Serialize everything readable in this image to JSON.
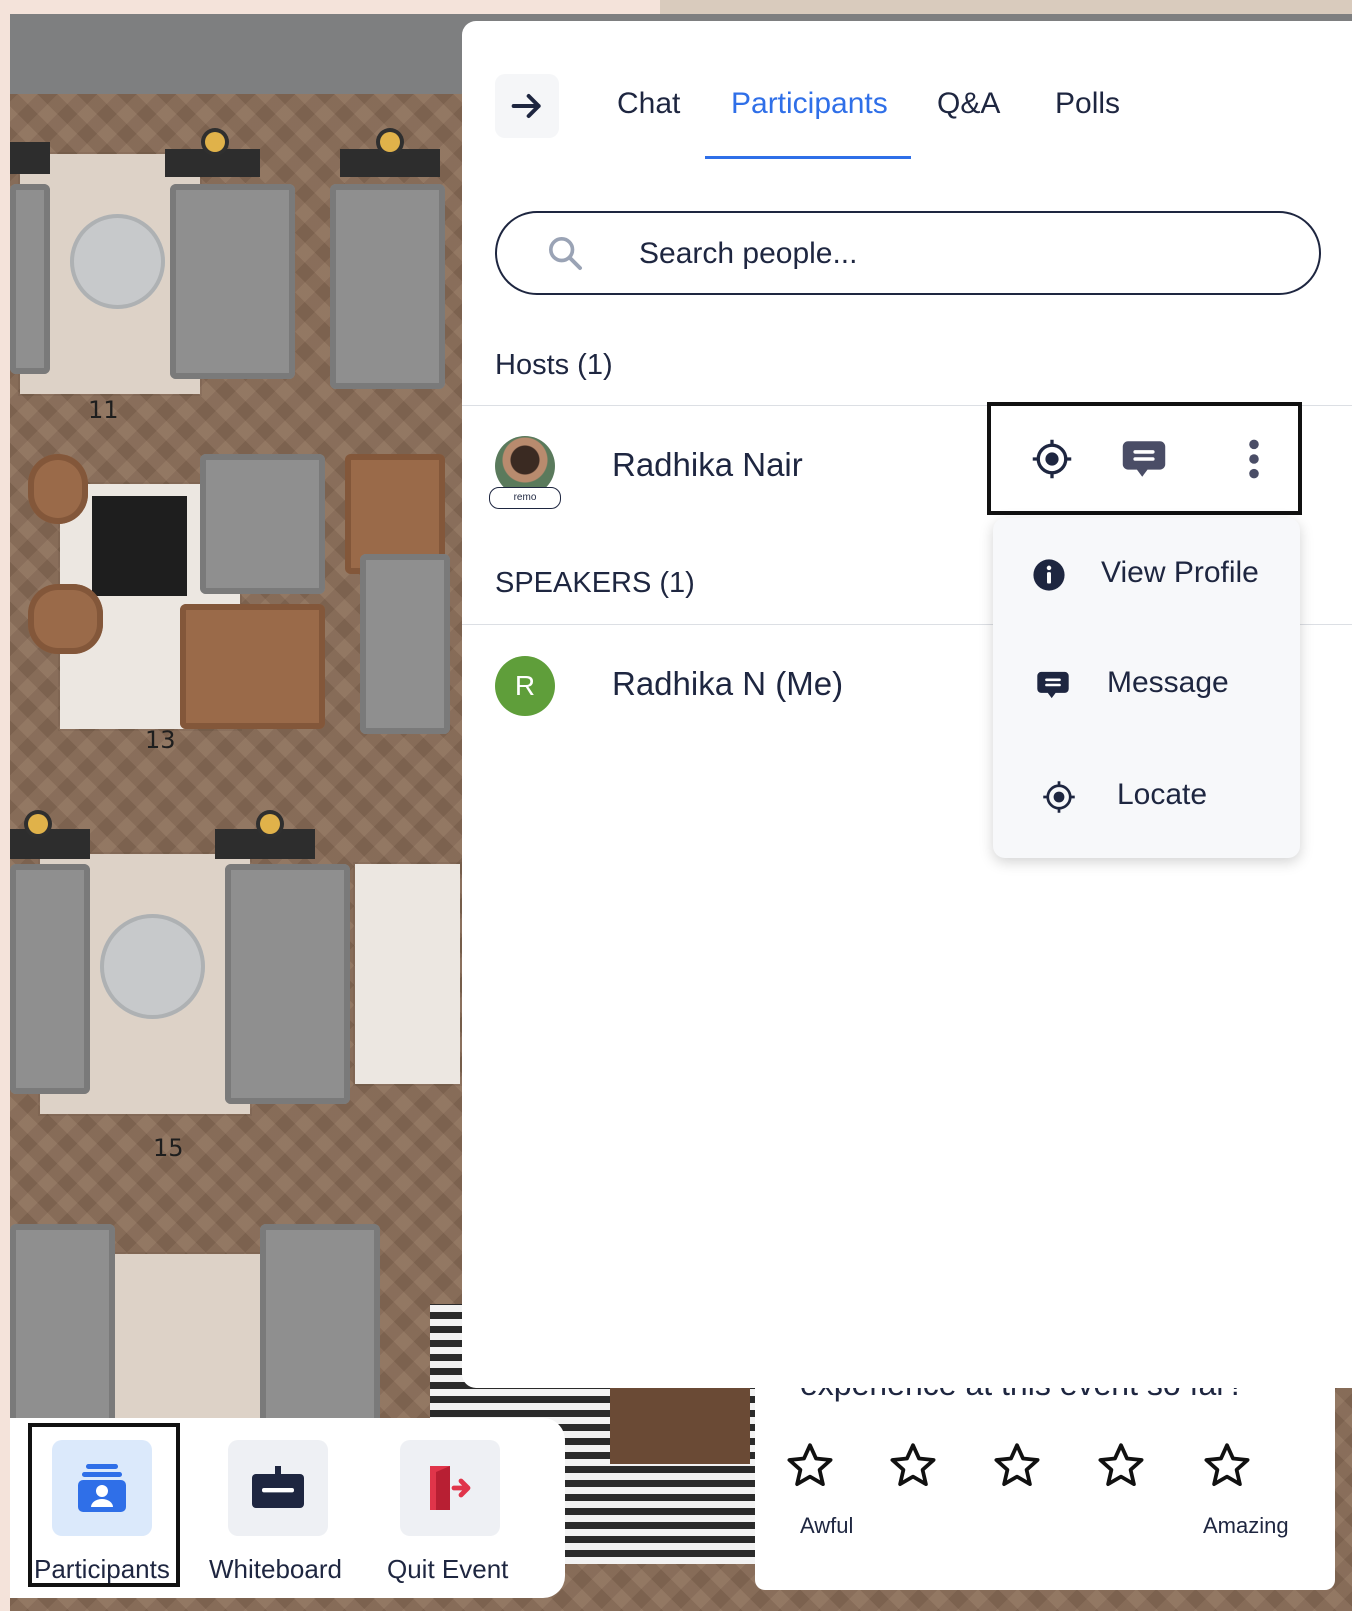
{
  "room": {
    "seat_numbers": [
      "11",
      "13",
      "15"
    ]
  },
  "panel": {
    "tabs": [
      {
        "label": "Chat"
      },
      {
        "label": "Participants",
        "active": true
      },
      {
        "label": "Q&A"
      },
      {
        "label": "Polls"
      }
    ],
    "search": {
      "placeholder": "Search people..."
    },
    "hosts": {
      "title": "Hosts (1)",
      "people": [
        {
          "name": "Radhika Nair",
          "avatar_badge": "remo"
        }
      ]
    },
    "speakers": {
      "title": "SPEAKERS (1)",
      "people": [
        {
          "name": "Radhika N (Me)",
          "avatar_initial": "R"
        }
      ]
    },
    "context_menu": {
      "items": [
        {
          "label": "View Profile",
          "icon": "info-icon"
        },
        {
          "label": "Message",
          "icon": "message-icon"
        },
        {
          "label": "Locate",
          "icon": "locate-icon"
        }
      ]
    }
  },
  "bottom_bar": {
    "buttons": [
      {
        "label": "Participants",
        "icon": "participants-icon"
      },
      {
        "label": "Whiteboard",
        "icon": "whiteboard-icon"
      },
      {
        "label": "Quit Event",
        "icon": "quit-icon"
      }
    ]
  },
  "rating": {
    "question_partial": "experience at this event so far?",
    "stars": 5,
    "low_label": "Awful",
    "high_label": "Amazing"
  },
  "colors": {
    "accent": "#2f6fe8",
    "text": "#1e2640",
    "quit": "#e0354a"
  }
}
